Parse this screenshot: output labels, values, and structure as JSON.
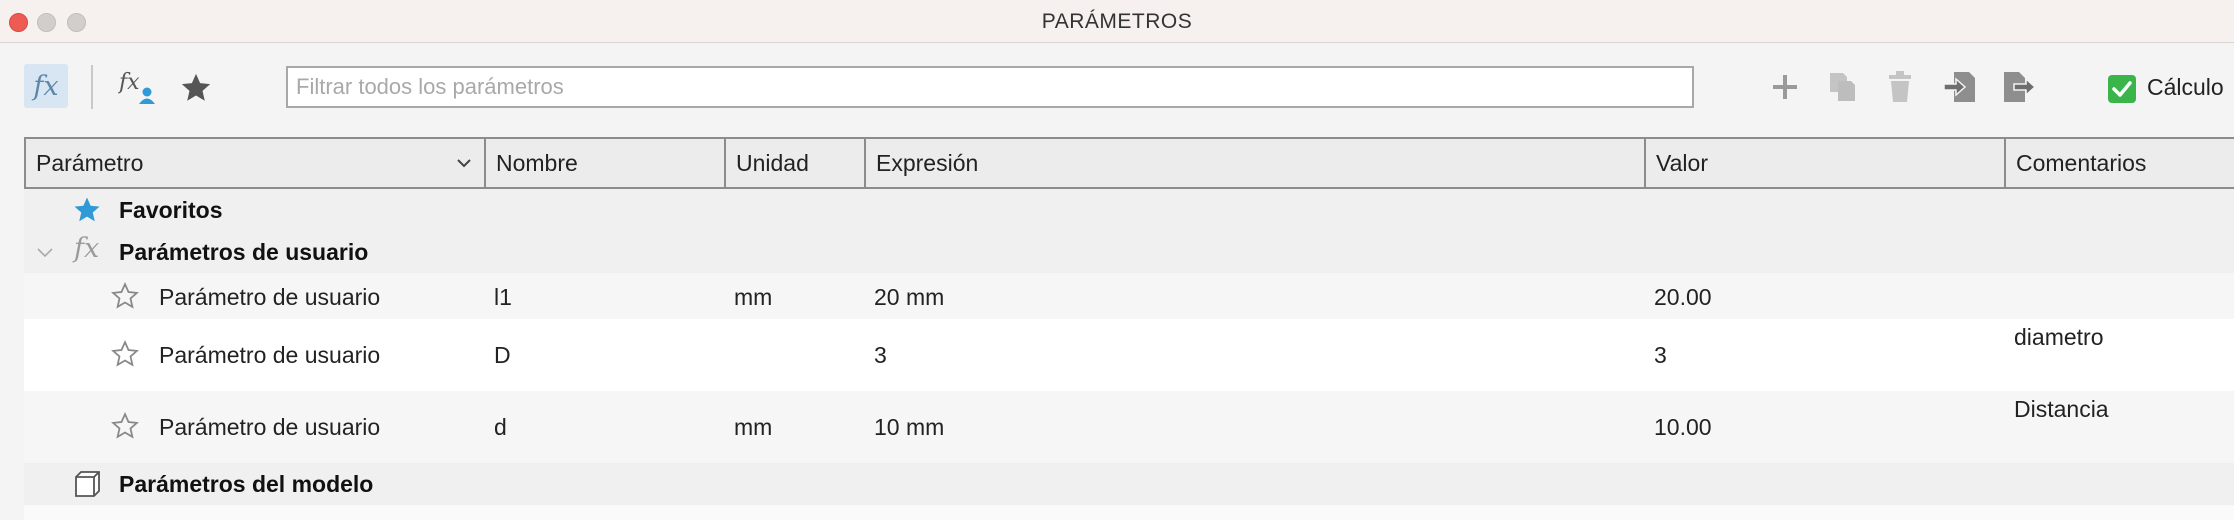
{
  "window": {
    "title": "PARÁMETROS"
  },
  "toolbar": {
    "filter_placeholder": "Filtrar todos los parámetros",
    "calc_label": "Cálculo",
    "calc_checked": true,
    "icons": [
      "fx-icon",
      "fx-user-icon",
      "favorite-star-icon",
      "add-icon",
      "copy-icon",
      "delete-icon",
      "import-icon",
      "export-icon"
    ]
  },
  "table": {
    "columns": [
      "Parámetro",
      "Nombre",
      "Unidad",
      "Expresión",
      "Valor",
      "Comentarios"
    ],
    "groups": {
      "favorites": "Favoritos",
      "user": "Parámetros de usuario",
      "model": "Parámetros del modelo"
    },
    "rows": [
      {
        "parameter": "Parámetro de usuario",
        "name": "l1",
        "unit": "mm",
        "expression": "20 mm",
        "value": "20.00",
        "comment": ""
      },
      {
        "parameter": "Parámetro de usuario",
        "name": "D",
        "unit": "",
        "expression": "3",
        "value": "3",
        "comment": "diametro"
      },
      {
        "parameter": "Parámetro de usuario",
        "name": "d",
        "unit": "mm",
        "expression": "10 mm",
        "value": "10.00",
        "comment": "Distancia"
      }
    ]
  },
  "colors": {
    "accent": "#2f9ad6",
    "check": "#39b54a",
    "close": "#ee5b52"
  }
}
